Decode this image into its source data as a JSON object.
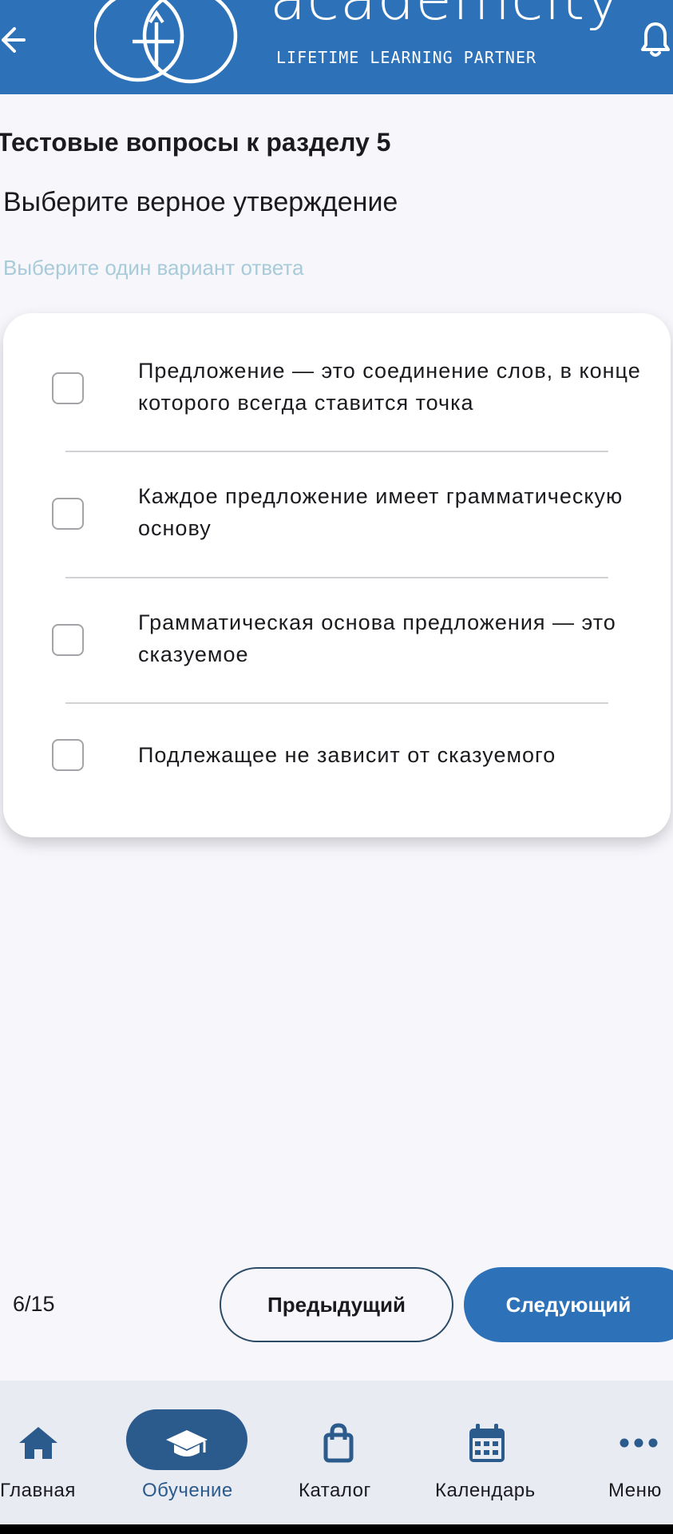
{
  "header": {
    "logo_word": "academcity",
    "logo_tagline": "LIFETIME LEARNING PARTNER",
    "accent_color": "#2d72b9"
  },
  "test": {
    "section_title": "Тестовые вопросы к разделу 5",
    "question": "Выберите верное утверждение",
    "hint": "Выберите один вариант ответа",
    "options": [
      {
        "label": "Предложение — это соединение слов, в конце которого всегда ставится точка",
        "checked": false
      },
      {
        "label": "Каждое предложение имеет грамматическую основу",
        "checked": false
      },
      {
        "label": "Грамматическая основа предложения — это сказуемое",
        "checked": false
      },
      {
        "label": "Подлежащее не зависит от сказуемого",
        "checked": false
      }
    ]
  },
  "pager": {
    "counter": "6/15",
    "prev_label": "Предыдущий",
    "next_label": "Следующий"
  },
  "nav": {
    "items": [
      {
        "label": "Главная",
        "icon": "home-icon",
        "active": false
      },
      {
        "label": "Обучение",
        "icon": "graduation-cap-icon",
        "active": true
      },
      {
        "label": "Каталог",
        "icon": "shopping-bag-icon",
        "active": false
      },
      {
        "label": "Календарь",
        "icon": "calendar-icon",
        "active": false
      },
      {
        "label": "Меню",
        "icon": "more-dots-icon",
        "active": false
      }
    ],
    "active_color": "#2b5a8c"
  }
}
